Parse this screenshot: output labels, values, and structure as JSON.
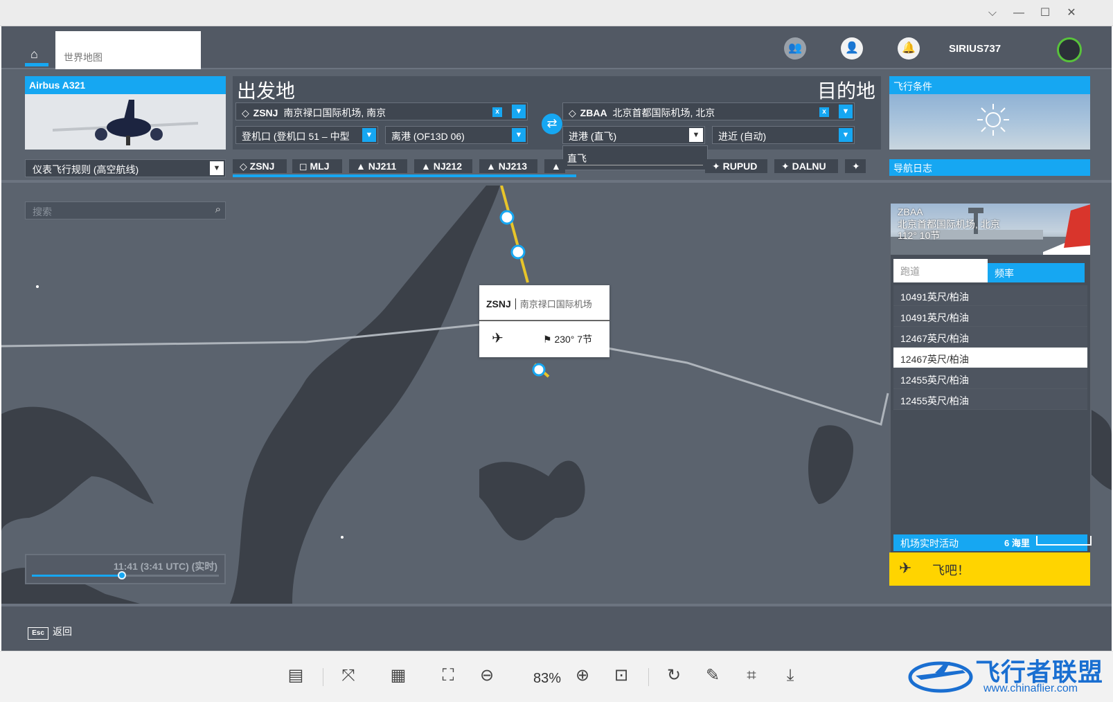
{
  "window": {
    "controls": [
      "⌵",
      "—",
      "☐",
      "✕"
    ]
  },
  "nav": {
    "home_icon": "home-icon",
    "world_map_tab": "世界地图",
    "icons": [
      "friends-icon",
      "profile-icon",
      "notification-icon"
    ],
    "username": "SIRIUS737"
  },
  "aircraft": {
    "name": "Airbus A321"
  },
  "departure": {
    "title": "出发地",
    "airport_code": "ZSNJ",
    "airport_name": "南京禄口国际机场, 南京",
    "gate": "登机口 (登机口 51 – 中型",
    "departure_proc": "离港 (OF13D 06)"
  },
  "destination": {
    "title": "目的地",
    "airport_code": "ZBAA",
    "airport_name": "北京首都国际机场, 北京",
    "arrival_proc": "进港 (直飞)",
    "approach": "进近 (自动)",
    "arrival_dropdown_option": "直飞"
  },
  "conditions": {
    "title": "飞行条件",
    "icon": "sun-icon"
  },
  "flight_rules": "仪表飞行规则 (高空航线)",
  "waypoints": [
    {
      "icon": "◇",
      "label": "ZSNJ"
    },
    {
      "icon": "◻",
      "label": "MLJ"
    },
    {
      "icon": "▲",
      "label": "NJ211"
    },
    {
      "icon": "▲",
      "label": "NJ212"
    },
    {
      "icon": "▲",
      "label": "NJ213"
    },
    {
      "icon": "▲",
      "label": ""
    },
    {
      "icon": "✦",
      "label": "RUPUD"
    },
    {
      "icon": "✦",
      "label": "DALNU"
    },
    {
      "icon": "✦",
      "label": ""
    }
  ],
  "nav_log": "导航日志",
  "search": {
    "placeholder": "搜索"
  },
  "popup": {
    "code": "ZSNJ",
    "name": "南京禄口国际机场",
    "wind": "230° 7节"
  },
  "airport_panel": {
    "code": "ZBAA",
    "name": "北京首都国际机场, 北京",
    "metar": "112° 10节",
    "tabs": [
      "跑道",
      "频率"
    ],
    "runways": [
      "10491英尺/柏油",
      "10491英尺/柏油",
      "12467英尺/柏油",
      "12467英尺/柏油",
      "12455英尺/柏油",
      "12455英尺/柏油"
    ],
    "selected_runway_index": 3,
    "live_activity": "机场实时活动"
  },
  "scale": "6 海里",
  "fly_button": "飞吧！",
  "time": {
    "label": "11:41 (3:41 UTC) (实时)",
    "progress": 0.48
  },
  "back": {
    "key": "Esc",
    "label": "返回"
  },
  "viewer": {
    "zoom": "83%"
  },
  "watermark": {
    "name": "飞行者联盟",
    "url": "www.chinaflier.com"
  },
  "colors": {
    "accent": "#16a7f2",
    "fly": "#ffd400",
    "route": "#e8c52a",
    "land": "#3b4048",
    "water": "#5b636e"
  }
}
